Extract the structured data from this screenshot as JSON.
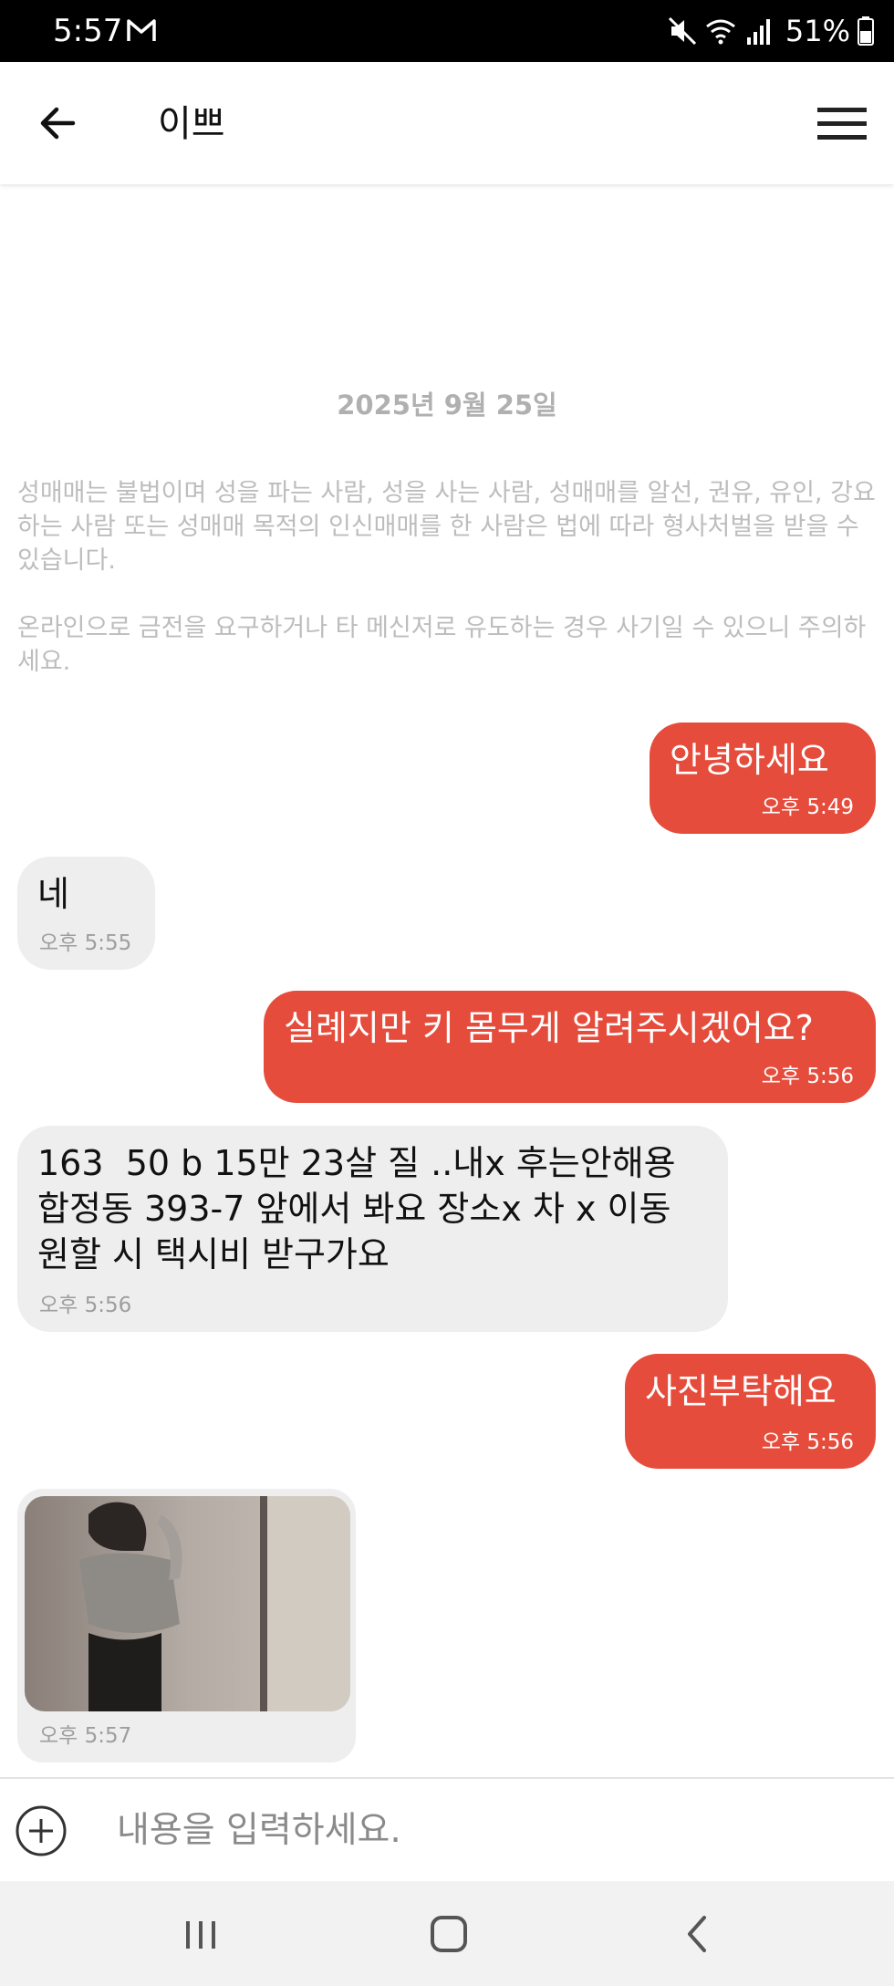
{
  "status_bar": {
    "time": "5:57",
    "battery_percent": "51%",
    "icons": [
      "gmail-icon",
      "mute-icon",
      "wifi-icon",
      "signal-icon",
      "battery-icon"
    ]
  },
  "header": {
    "title": "이쁘",
    "back_icon": "arrow-left-icon",
    "menu_icon": "hamburger-menu-icon"
  },
  "chat": {
    "date": "2025년 9월 25일",
    "notice": [
      "성매매는 불법이며 성을 파는 사람, 성을 사는 사람, 성매매를 알선, 권유, 유인, 강요하는 사람 또는 성매매 목적의 인신매매를 한 사람은 법에 따라 형사처벌을 받을 수 있습니다.",
      "온라인으로 금전을 요구하거나 타 메신저로 유도하는 경우 사기일 수 있으니 주의하세요."
    ],
    "messages": [
      {
        "direction": "out",
        "text": "안녕하세요",
        "time": "오후 5:49"
      },
      {
        "direction": "in",
        "text": "네",
        "time": "오후 5:55"
      },
      {
        "direction": "out",
        "text": "실례지만 키 몸무게 알려주시겠어요?",
        "time": "오후 5:56"
      },
      {
        "direction": "in",
        "text": "163  50 b 15만 23살 질 ..내x 후는안해용\n합정동 393-7 앞에서 봐요 장소x 차 x 이동\n원할 시 택시비 받구가요",
        "time": "오후 5:56"
      },
      {
        "direction": "out",
        "text": "사진부탁해요",
        "time": "오후 5:56"
      },
      {
        "direction": "in",
        "type": "photo",
        "time": "오후 5:57"
      }
    ]
  },
  "input": {
    "placeholder": "내용을 입력하세요.",
    "value": "",
    "attach_icon": "plus-circle-icon"
  },
  "nav_bar": {
    "icons": [
      "recent-apps-icon",
      "home-icon",
      "back-icon"
    ]
  },
  "colors": {
    "outgoing_bubble": "#e64c3c",
    "incoming_bubble": "#eeeeee",
    "notice_text": "#bdbdbd"
  }
}
